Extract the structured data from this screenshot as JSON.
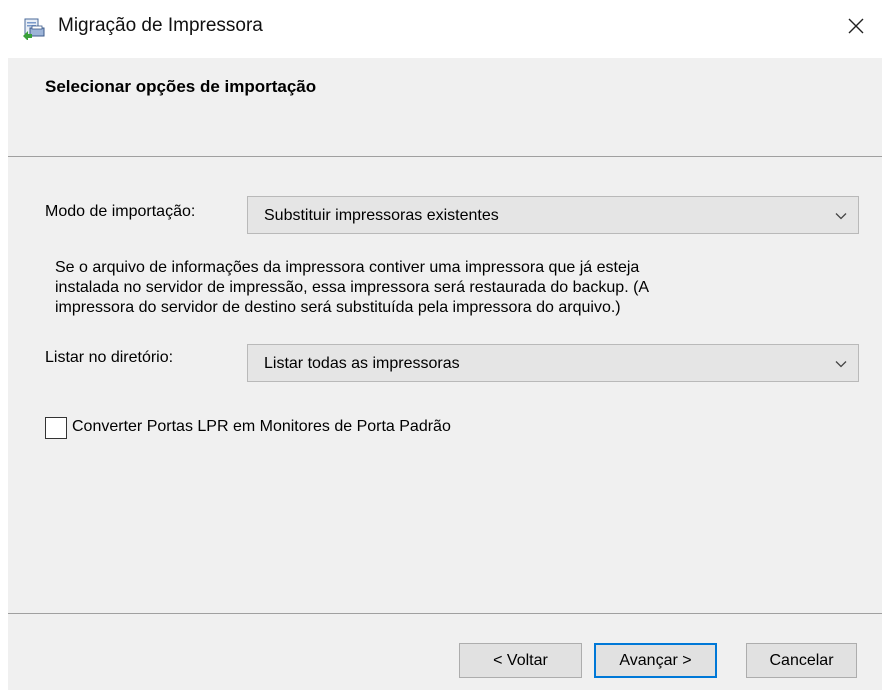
{
  "window": {
    "title": "Migração de Impressora",
    "icon": "printer-migration-icon"
  },
  "header": {
    "title": "Selecionar opções de importação"
  },
  "form": {
    "import_mode": {
      "label": "Modo de importação:",
      "selected": "Substituir impressoras existentes"
    },
    "description_lines": [
      "Se o arquivo de informações da impressora contiver uma impressora que já esteja",
      "instalada no servidor de impressão, essa impressora será restaurada do backup. (A",
      "impressora do servidor de destino será substituída pela impressora do arquivo.)"
    ],
    "list_in_directory": {
      "label": "Listar no diretório:",
      "selected": "Listar todas as impressoras"
    },
    "convert_lpr": {
      "label": "Converter Portas LPR em Monitores de Porta Padrão",
      "checked": false
    }
  },
  "buttons": {
    "back": "< Voltar",
    "next": "Avançar >",
    "cancel": "Cancelar"
  },
  "colors": {
    "panel_background": "#f0f0f0",
    "default_button_border": "#0078d7"
  }
}
